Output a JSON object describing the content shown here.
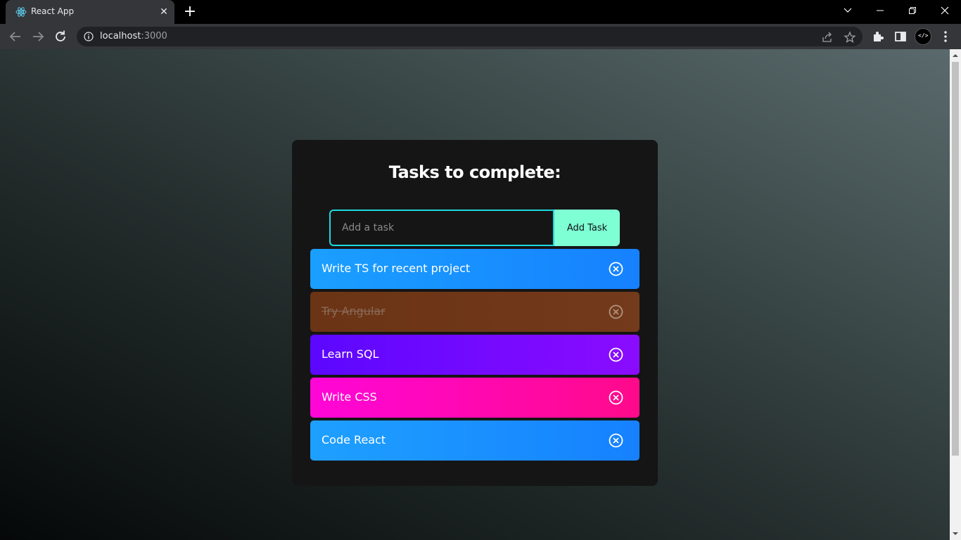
{
  "browser": {
    "tab_title": "React App",
    "tab_close": "✕",
    "new_tab": "+",
    "url_host": "localhost",
    "url_port": ":3000"
  },
  "app": {
    "title": "Tasks to complete:",
    "input_placeholder": "Add a task",
    "add_button": "Add Task",
    "accent_color": "#1fd8e0",
    "button_color": "#7effd4",
    "tasks": [
      {
        "label": "Write TS for recent project",
        "completed": false,
        "color_start": "#1a9fff",
        "color_end": "#1681ff"
      },
      {
        "label": "Try Angular",
        "completed": true,
        "color_start": "#6b3415",
        "color_end": "#733a1b"
      },
      {
        "label": "Learn SQL",
        "completed": false,
        "color_start": "#5c07ff",
        "color_end": "#8a0cff"
      },
      {
        "label": "Write CSS",
        "completed": false,
        "color_start": "#ff06d8",
        "color_end": "#ff0a8a"
      },
      {
        "label": "Code React",
        "completed": false,
        "color_start": "#1ea0ff",
        "color_end": "#1681ff"
      }
    ]
  }
}
